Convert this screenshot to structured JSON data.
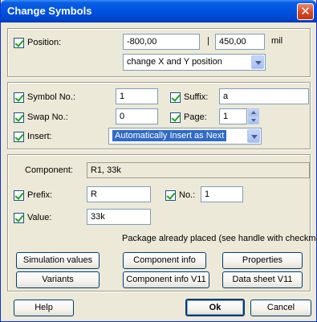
{
  "window": {
    "title": "Change Symbols",
    "close_glyph": "✕"
  },
  "position": {
    "label": "Position:",
    "x_value": "-800,00",
    "separator": "|",
    "y_value": "450,00",
    "unit": "mil",
    "mode_selected": "change X and Y position"
  },
  "symbol": {
    "symbol_no_label": "Symbol No.:",
    "symbol_no_value": "1",
    "suffix_label": "Suffix:",
    "suffix_value": "a",
    "swap_no_label": "Swap No.:",
    "swap_no_value": "0",
    "page_label": "Page:",
    "page_value": "1",
    "insert_label": "Insert:",
    "insert_selected": "Automatically Insert as Next"
  },
  "component": {
    "label": "Component:",
    "value": "R1, 33k",
    "prefix_label": "Prefix:",
    "prefix_value": "R",
    "no_label": "No.:",
    "no_value": "1",
    "value_label": "Value:",
    "value_value": "33k",
    "package_status": "Package already placed (see handle with checkmark)"
  },
  "buttons": {
    "simulation_values": "Simulation values",
    "component_info": "Component info",
    "properties": "Properties",
    "variants": "Variants",
    "component_info_v11": "Component info V11",
    "data_sheet_v11": "Data sheet V11",
    "help": "Help",
    "ok": "Ok",
    "cancel": "Cancel"
  }
}
